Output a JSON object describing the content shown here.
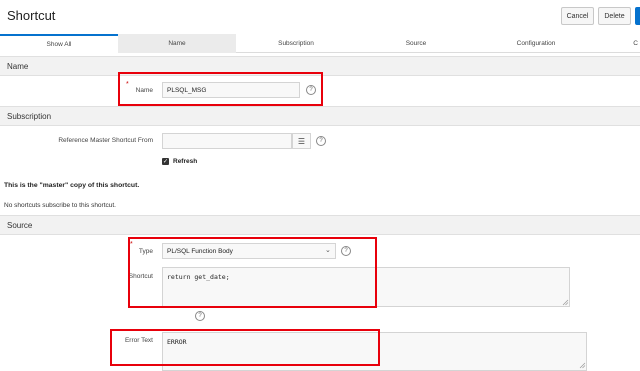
{
  "header": {
    "title": "Shortcut",
    "cancel_label": "Cancel",
    "delete_label": "Delete"
  },
  "tabs": [
    {
      "label": "Show All"
    },
    {
      "label": "Name"
    },
    {
      "label": "Subscription"
    },
    {
      "label": "Source"
    },
    {
      "label": "Configuration"
    },
    {
      "label": "C"
    }
  ],
  "name_section": {
    "title": "Name",
    "name_label": "Name",
    "name_value": "PLSQL_MSG",
    "required_mark": "*"
  },
  "subscription_section": {
    "title": "Subscription",
    "ref_label": "Reference Master Shortcut From",
    "ref_value": "",
    "refresh_label": "Refresh",
    "master_note": "This is the \"master\" copy of this shortcut.",
    "subscribe_note": "No shortcuts subscribe to this shortcut."
  },
  "source_section": {
    "title": "Source",
    "type_label": "Type",
    "type_value": "PL/SQL Function Body",
    "required_mark": "*",
    "shortcut_label": "Shortcut",
    "shortcut_value": "return get_date;",
    "error_label": "Error Text",
    "error_value": "ERROR"
  },
  "icons": {
    "help": "?",
    "checkbox": "✓",
    "select_arrow": "⌄",
    "list": "☰"
  },
  "colors": {
    "accent": "#0572ce",
    "highlight": "#e8000b"
  }
}
